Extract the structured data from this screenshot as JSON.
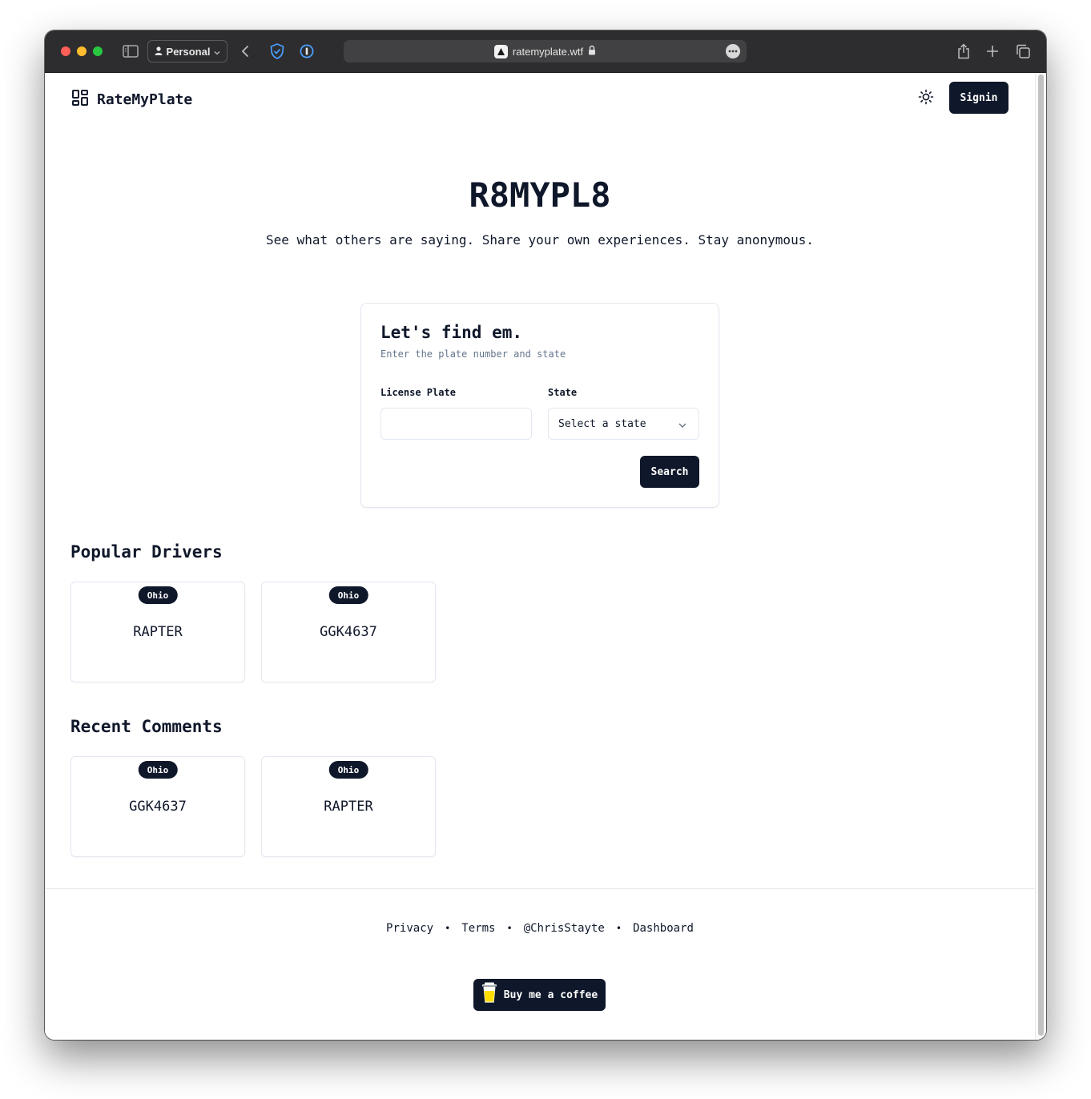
{
  "browser": {
    "profile_label": "Personal",
    "url": "ratemyplate.wtf"
  },
  "header": {
    "logo_text": "RateMyPlate",
    "signin_label": "Signin"
  },
  "hero": {
    "title": "R8MYPL8",
    "subtitle": "See what others are saying. Share your own experiences. Stay anonymous."
  },
  "search_card": {
    "title": "Let's find em.",
    "description": "Enter the plate number and state",
    "plate_label": "License Plate",
    "plate_value": "",
    "state_label": "State",
    "state_placeholder": "Select a state",
    "search_label": "Search"
  },
  "popular": {
    "title": "Popular Drivers",
    "items": [
      {
        "state": "Ohio",
        "plate": "RAPTER"
      },
      {
        "state": "Ohio",
        "plate": "GGK4637"
      }
    ]
  },
  "recent": {
    "title": "Recent Comments",
    "items": [
      {
        "state": "Ohio",
        "plate": "GGK4637"
      },
      {
        "state": "Ohio",
        "plate": "RAPTER"
      }
    ]
  },
  "footer": {
    "links": [
      "Privacy",
      "Terms",
      "@ChrisStayte",
      "Dashboard"
    ],
    "separator": "•",
    "coffee_label": "Buy me a coffee"
  },
  "colors": {
    "primary": "#0f172a",
    "muted_text": "#64748b",
    "border": "#e2e8f0",
    "titlebar": "#2d2d2f"
  }
}
